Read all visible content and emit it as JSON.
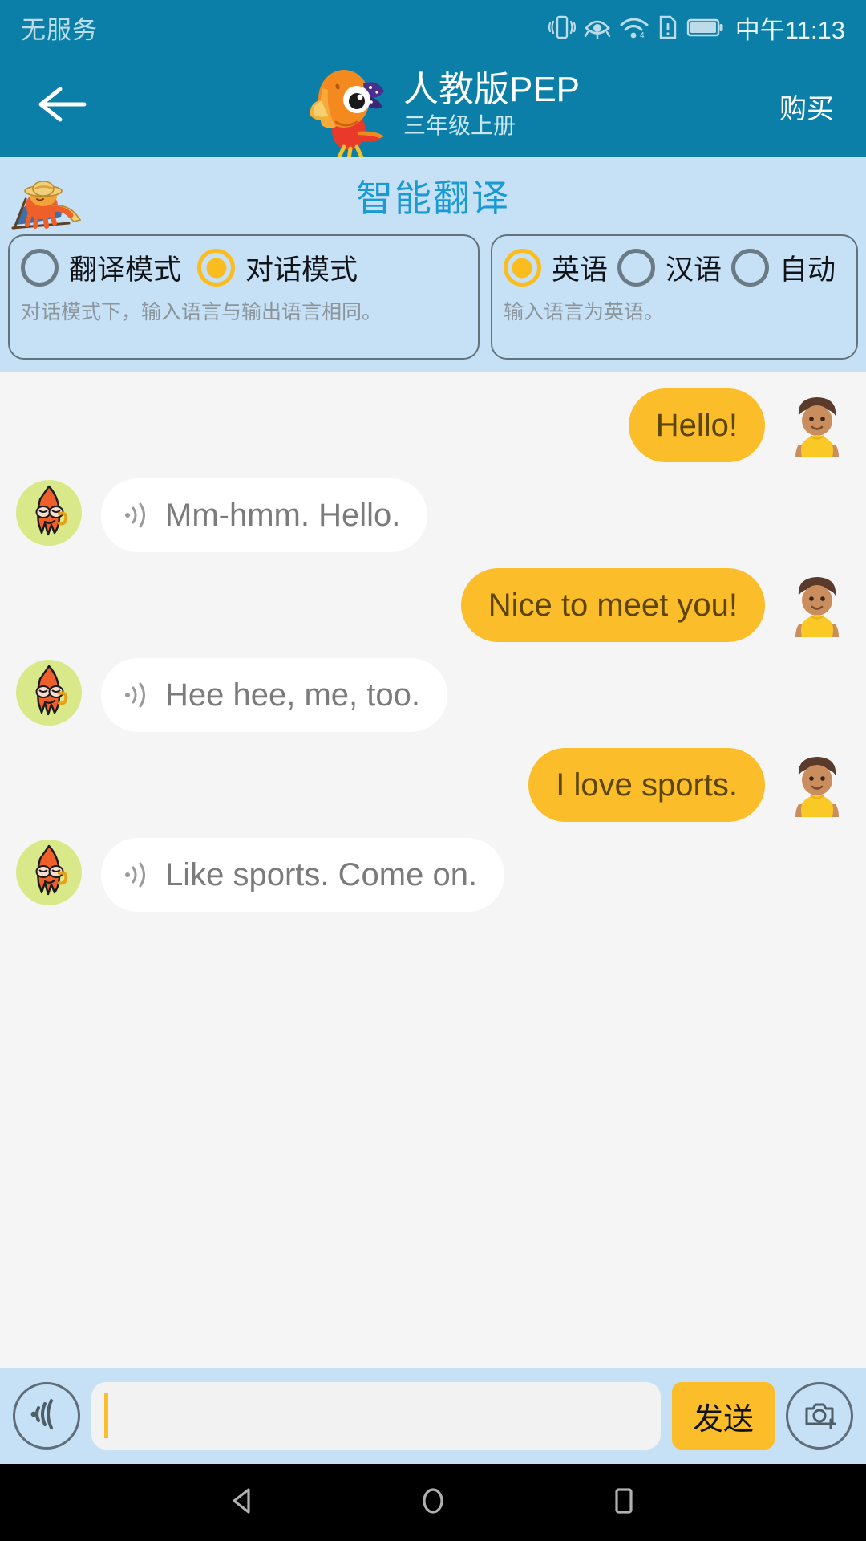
{
  "status_bar": {
    "carrier": "无服务",
    "time": "中午11:13",
    "icons": [
      "vibrate-icon",
      "eye-comfort-icon",
      "wifi-icon",
      "sim-alert-icon",
      "battery-icon"
    ]
  },
  "app_bar": {
    "back_icon": "arrow-left-icon",
    "logo_icon": "parrot-mascot-icon",
    "title": "人教版PEP",
    "subtitle": "三年级上册",
    "buy_label": "购买"
  },
  "settings": {
    "mascot_icon": "octopus-lounging-icon",
    "title": "智能翻译",
    "mode_card": {
      "options": [
        {
          "label": "翻译模式",
          "selected": false
        },
        {
          "label": "对话模式",
          "selected": true
        }
      ],
      "hint": "对话模式下，输入语言与输出语言相同。"
    },
    "language_card": {
      "options": [
        {
          "label": "英语",
          "selected": true
        },
        {
          "label": "汉语",
          "selected": false
        },
        {
          "label": "自动",
          "selected": false
        }
      ],
      "hint": "输入语言为英语。"
    }
  },
  "chat": {
    "messages": [
      {
        "sender": "user",
        "text": "Hello!",
        "avatar_icon": "boy-avatar-icon"
      },
      {
        "sender": "bot",
        "text": "Mm-hmm. Hello.",
        "avatar_icon": "octopus-avatar-icon",
        "speaker_icon": "speaker-icon"
      },
      {
        "sender": "user",
        "text": "Nice to meet you!",
        "avatar_icon": "boy-avatar-icon"
      },
      {
        "sender": "bot",
        "text": "Hee hee, me, too.",
        "avatar_icon": "octopus-avatar-icon",
        "speaker_icon": "speaker-icon"
      },
      {
        "sender": "user",
        "text": "I love sports.",
        "avatar_icon": "boy-avatar-icon"
      },
      {
        "sender": "bot",
        "text": "Like sports. Come on.",
        "avatar_icon": "octopus-avatar-icon",
        "speaker_icon": "speaker-icon"
      }
    ]
  },
  "input_bar": {
    "voice_icon": "voice-input-icon",
    "input_value": "",
    "input_placeholder": "",
    "send_label": "发送",
    "camera_icon": "camera-add-icon"
  },
  "nav_bar": {
    "back_icon": "nav-back-triangle-icon",
    "home_icon": "nav-home-circle-icon",
    "recents_icon": "nav-recents-square-icon"
  },
  "colors": {
    "header_blue": "#0b7fa8",
    "panel_blue": "#c6e0f5",
    "accent_yellow": "#fbbd2a",
    "title_blue": "#1a9ad4",
    "chat_bg": "#f5f5f5"
  }
}
